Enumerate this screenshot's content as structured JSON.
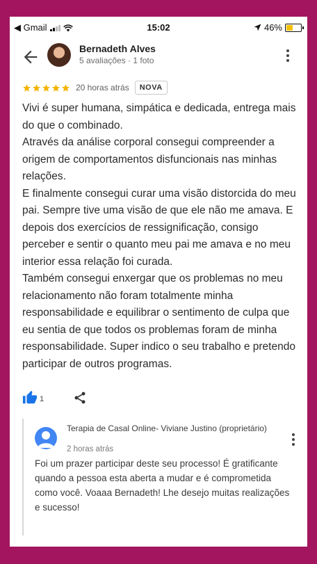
{
  "status_bar": {
    "carrier": "◀ Gmail",
    "time": "15:02",
    "battery_pct": "46%",
    "battery_level": 0.46
  },
  "header": {
    "reviewer_name": "Bernadeth Alves",
    "reviewer_meta": "5 avaliações · 1 foto"
  },
  "rating": {
    "stars": 5,
    "time_ago": "20 horas atrás",
    "badge": "NOVA"
  },
  "review": {
    "paragraphs": [
      "Vivi é super humana, simpática e dedicada, entrega mais do que o combinado.",
      "Através da análise corporal consegui compreender a origem de comportamentos disfuncionais nas minhas relações.",
      "E finalmente consegui curar uma visão distorcida do meu pai. Sempre tive uma visão de que ele não me amava. E depois dos exercícios de ressignificação, consigo perceber e sentir o quanto meu pai me amava e no meu interior essa relação foi curada.",
      "Também consegui enxergar que os problemas no meu relacionamento não foram totalmente minha responsabilidade e equilibrar o sentimento de culpa que eu sentia de que todos os problemas foram de minha responsabilidade. Super indico o seu trabalho e pretendo participar de outros programas."
    ]
  },
  "actions": {
    "like_count": "1"
  },
  "owner_reply": {
    "owner_name": "Terapia de Casal Online- Viviane Justino (proprietário)",
    "time_ago": "2 horas atrás",
    "text": "Foi um prazer participar deste seu processo! É gratificante quando a pessoa esta aberta a mudar e é comprometida como você. Voaaa Bernadeth! Lhe desejo muitas realizações e sucesso!"
  },
  "colors": {
    "page_background": "#a3155f",
    "star": "#f4b400",
    "like": "#1a73e8"
  },
  "icons": [
    "back-arrow-icon",
    "more-vert-icon",
    "star-icon",
    "thumbs-up-icon",
    "share-icon",
    "location-arrow-icon",
    "wifi-icon",
    "signal-icon",
    "battery-icon"
  ]
}
